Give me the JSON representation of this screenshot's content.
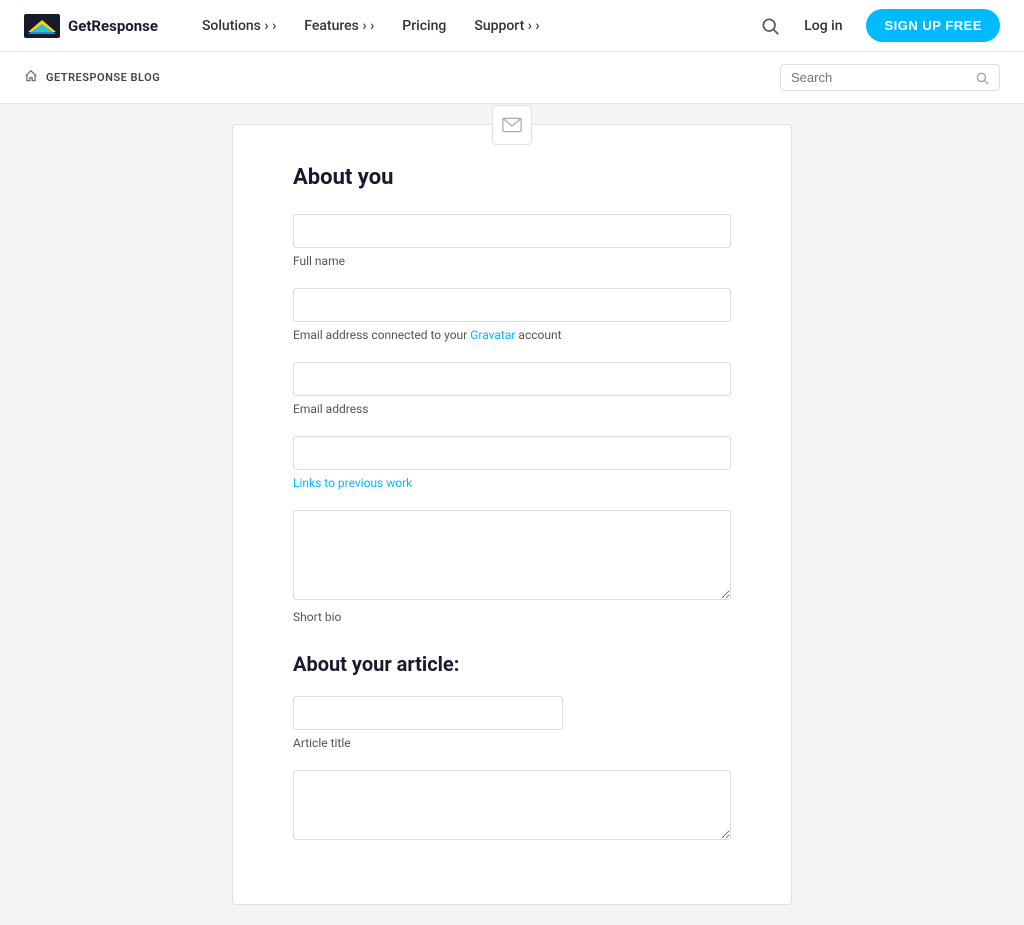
{
  "navbar": {
    "logo_text": "GetResponse",
    "nav_items": [
      {
        "label": "Solutions",
        "has_arrow": true,
        "name": "solutions"
      },
      {
        "label": "Features",
        "has_arrow": true,
        "name": "features"
      },
      {
        "label": "Pricing",
        "has_arrow": false,
        "name": "pricing"
      },
      {
        "label": "Support",
        "has_arrow": true,
        "name": "support"
      }
    ],
    "login_label": "Log in",
    "signup_label": "SIGN UP FREE"
  },
  "breadcrumb": {
    "home_icon": "🏠",
    "label": "GETRESPONSE BLOG"
  },
  "blog_search": {
    "placeholder": "Search"
  },
  "form": {
    "card_icon": "✉",
    "about_you_title": "About you",
    "fields": {
      "full_name_label": "Full name",
      "email_gravatar_label_prefix": "Email address connected to your ",
      "gravatar_link": "Gravatar",
      "email_gravatar_label_suffix": " account",
      "email_address_label": "Email address",
      "links_label": "Links to previous work",
      "short_bio_label": "Short bio"
    },
    "about_article_title": "About your article:",
    "article_fields": {
      "article_title_label": "Article title"
    }
  }
}
